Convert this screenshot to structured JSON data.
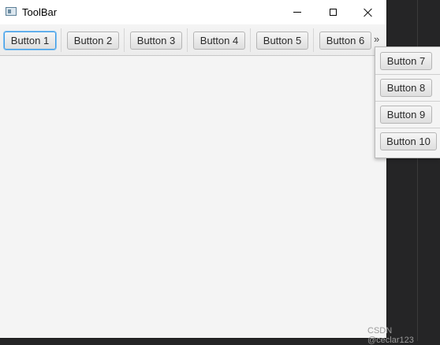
{
  "window": {
    "title": "ToolBar"
  },
  "toolbar": {
    "buttons": [
      "Button 1",
      "Button 2",
      "Button 3",
      "Button 4",
      "Button 5",
      "Button 6"
    ],
    "overflow_label": "»"
  },
  "overflow_menu": {
    "buttons": [
      "Button 7",
      "Button 8",
      "Button 9",
      "Button 10"
    ]
  },
  "watermark": "CSDN @ceclar123",
  "icons": {
    "app": "app-window-icon",
    "minimize": "minimize-icon",
    "maximize": "maximize-icon",
    "close": "close-icon",
    "overflow": "double-chevron-right-icon"
  },
  "colors": {
    "focus_ring": "#3c9be6",
    "window_bg": "#f4f4f4",
    "desktop_bg": "#252526"
  }
}
